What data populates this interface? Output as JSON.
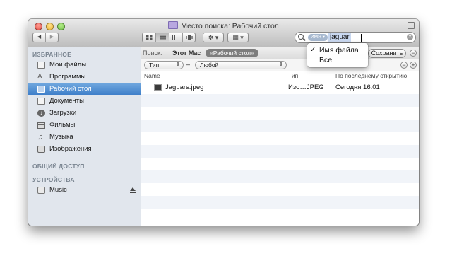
{
  "window": {
    "title": "Место поиска: Рабочий стол"
  },
  "toolbar": {
    "nav_back": "◀",
    "nav_forward": "▶",
    "view_modes": [
      "icon-view",
      "list-view",
      "column-view",
      "coverflow-view"
    ],
    "active_view": "list-view",
    "action_label": "✲ ▾",
    "arrange_label": "▦ ▾",
    "search": {
      "token": "ИМЯ ▾",
      "query": "jaguar"
    }
  },
  "sidebar": {
    "favorites_header": "ИЗБРАННОЕ",
    "favorites": [
      {
        "label": "Мои файлы",
        "icon": "all-my-files-icon"
      },
      {
        "label": "Программы",
        "icon": "applications-icon"
      },
      {
        "label": "Рабочий стол",
        "icon": "desktop-icon",
        "selected": true
      },
      {
        "label": "Документы",
        "icon": "documents-icon"
      },
      {
        "label": "Загрузки",
        "icon": "downloads-icon"
      },
      {
        "label": "Фильмы",
        "icon": "movies-icon"
      },
      {
        "label": "Музыка",
        "icon": "music-icon"
      },
      {
        "label": "Изображения",
        "icon": "pictures-icon"
      }
    ],
    "shared_header": "ОБЩИЙ ДОСТУП",
    "devices_header": "УСТРОЙСТВА",
    "devices": [
      {
        "label": "Music",
        "icon": "drive-icon",
        "eject": true
      }
    ]
  },
  "scope": {
    "label": "Поиск:",
    "this_mac": "Этот Mac",
    "current": "«Рабочий стол»",
    "save_label": "Сохранить",
    "remove_symbol": "−"
  },
  "criteria": {
    "attribute": "Тип",
    "separator": "–",
    "value": "Любой",
    "remove_symbol": "−",
    "add_symbol": "+"
  },
  "columns": {
    "name": "Name",
    "kind": "Тип",
    "last_opened": "По последнему открытию"
  },
  "files": [
    {
      "name": "Jaguars.jpeg",
      "kind": "Изо…JPEG",
      "last_opened": "Сегодня 16:01"
    }
  ],
  "search_menu": {
    "items": [
      {
        "label": "Имя файла",
        "checked": true
      },
      {
        "label": "Все",
        "checked": false
      }
    ],
    "check_glyph": "✓"
  }
}
